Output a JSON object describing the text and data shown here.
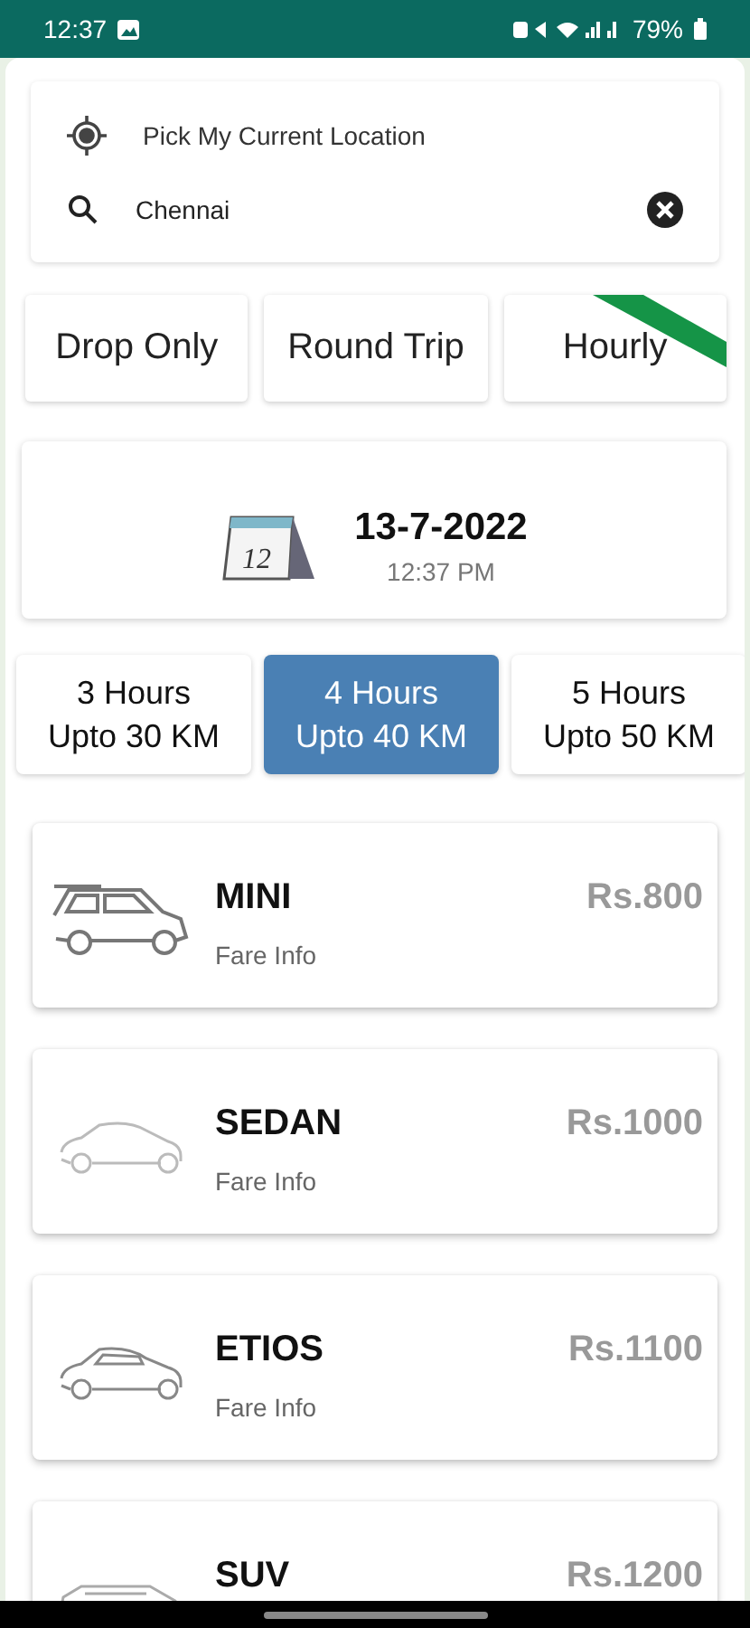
{
  "status_bar": {
    "time": "12:37",
    "battery": "79%"
  },
  "location": {
    "current_location": "Pick My Current Location",
    "search_value": "Chennai"
  },
  "trip_types": [
    {
      "label": "Drop Only",
      "selected": false
    },
    {
      "label": "Round Trip",
      "selected": false
    },
    {
      "label": "Hourly",
      "selected": true
    }
  ],
  "pickup": {
    "date": "13-7-2022",
    "time": "12:37 PM",
    "calendar_day": "12"
  },
  "packages": [
    {
      "hours": "3 Hours",
      "distance": "Upto 30 KM",
      "selected": false
    },
    {
      "hours": "4 Hours",
      "distance": "Upto 40 KM",
      "selected": true
    },
    {
      "hours": "5 Hours",
      "distance": "Upto 50 KM",
      "selected": false
    }
  ],
  "cars": [
    {
      "name": "MINI",
      "price": "Rs.800",
      "fare_info": "Fare Info"
    },
    {
      "name": "SEDAN",
      "price": "Rs.1000",
      "fare_info": "Fare Info"
    },
    {
      "name": "ETIOS",
      "price": "Rs.1100",
      "fare_info": "Fare Info"
    },
    {
      "name": "SUV",
      "price": "Rs.1200"
    }
  ]
}
